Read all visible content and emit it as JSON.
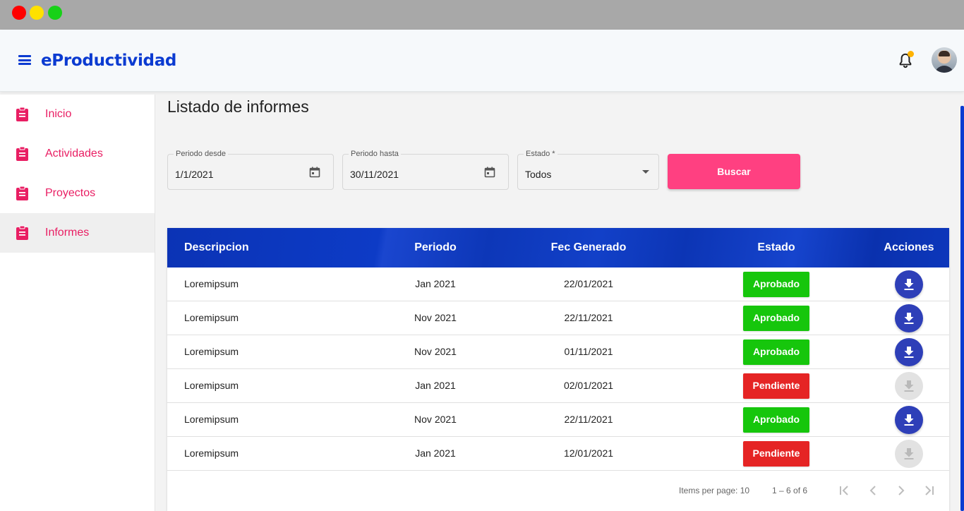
{
  "app": {
    "brand": "eProductividad"
  },
  "sidebar": {
    "items": [
      {
        "label": "Inicio"
      },
      {
        "label": "Actividades"
      },
      {
        "label": "Proyectos"
      },
      {
        "label": "Informes"
      }
    ]
  },
  "main": {
    "title": "Listado de informes",
    "filters": {
      "desde_label": "Periodo desde",
      "desde_value": "1/1/2021",
      "hasta_label": "Periodo hasta",
      "hasta_value": "30/11/2021",
      "estado_label": "Estado *",
      "estado_value": "Todos",
      "search_label": "Buscar"
    },
    "table": {
      "headers": {
        "desc": "Descripcion",
        "periodo": "Periodo",
        "fec": "Fec Generado",
        "estado": "Estado",
        "acciones": "Acciones"
      },
      "rows": [
        {
          "desc": "Loremipsum",
          "periodo": "Jan 2021",
          "fec": "22/01/2021",
          "estado": "Aprobado"
        },
        {
          "desc": "Loremipsum",
          "periodo": "Nov 2021",
          "fec": "22/11/2021",
          "estado": "Aprobado"
        },
        {
          "desc": "Loremipsum",
          "periodo": "Nov 2021",
          "fec": "01/11/2021",
          "estado": "Aprobado"
        },
        {
          "desc": "Loremipsum",
          "periodo": "Jan 2021",
          "fec": "02/01/2021",
          "estado": "Pendiente"
        },
        {
          "desc": "Loremipsum",
          "periodo": "Nov 2021",
          "fec": "22/11/2021",
          "estado": "Aprobado"
        },
        {
          "desc": "Loremipsum",
          "periodo": "Jan 2021",
          "fec": "12/01/2021",
          "estado": "Pendiente"
        }
      ],
      "pagination": {
        "items_per_page": "Items per page: 10",
        "range": "1 – 6 of 6"
      }
    }
  },
  "colors": {
    "brand": "#0b3bd1",
    "accent": "#ff4081",
    "approved": "#16c60c",
    "pending": "#e52424",
    "download": "#2e3fb8"
  },
  "icons": {
    "menu": "menu-icon",
    "bell": "bell-icon",
    "clipboard": "clipboard-icon",
    "calendar": "calendar-icon",
    "download": "download-icon",
    "first": "first-page-icon",
    "prev": "chevron-left-icon",
    "next": "chevron-right-icon",
    "last": "last-page-icon"
  }
}
